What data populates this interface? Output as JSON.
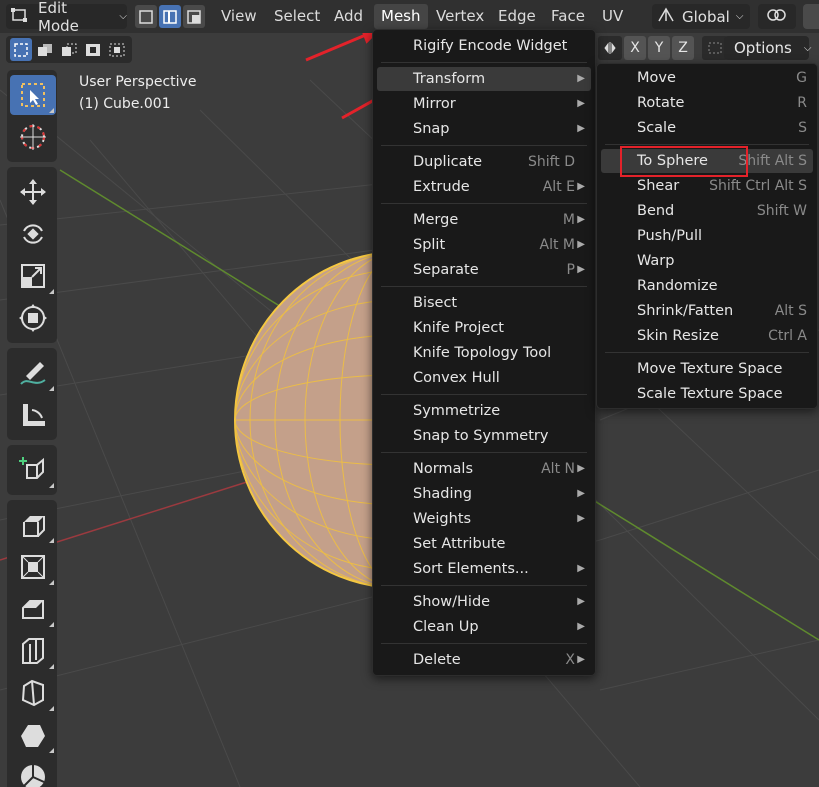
{
  "header": {
    "mode": "Edit Mode",
    "menus": [
      "View",
      "Select",
      "Add",
      "Mesh",
      "Vertex",
      "Edge",
      "Face",
      "UV"
    ],
    "active_menu": "Mesh",
    "orientation": "Global",
    "axes": [
      "X",
      "Y",
      "Z"
    ],
    "options": "Options"
  },
  "viewport": {
    "perspective": "User Perspective",
    "object": "(1) Cube.001"
  },
  "colors": {
    "accent": "#4772b3",
    "menu_bg": "#191919",
    "highlight_red": "#e3222a",
    "sphere": "#c8a48c",
    "wire": "#f5c842"
  },
  "mesh_menu": {
    "items": [
      {
        "label": "Rigify Encode Widget",
        "shortcut": "",
        "submenu": false
      },
      {
        "label": "Transform",
        "shortcut": "",
        "submenu": true
      },
      {
        "label": "Mirror",
        "shortcut": "",
        "submenu": true
      },
      {
        "label": "Snap",
        "shortcut": "",
        "submenu": true
      },
      {
        "label": "Duplicate",
        "shortcut": "Shift D",
        "submenu": false
      },
      {
        "label": "Extrude",
        "shortcut": "Alt E",
        "submenu": true
      },
      {
        "label": "Merge",
        "shortcut": "M",
        "submenu": true
      },
      {
        "label": "Split",
        "shortcut": "Alt M",
        "submenu": true
      },
      {
        "label": "Separate",
        "shortcut": "P",
        "submenu": true
      },
      {
        "label": "Bisect",
        "shortcut": "",
        "submenu": false
      },
      {
        "label": "Knife Project",
        "shortcut": "",
        "submenu": false
      },
      {
        "label": "Knife Topology Tool",
        "shortcut": "",
        "submenu": false
      },
      {
        "label": "Convex Hull",
        "shortcut": "",
        "submenu": false
      },
      {
        "label": "Symmetrize",
        "shortcut": "",
        "submenu": false
      },
      {
        "label": "Snap to Symmetry",
        "shortcut": "",
        "submenu": false
      },
      {
        "label": "Normals",
        "shortcut": "Alt N",
        "submenu": true
      },
      {
        "label": "Shading",
        "shortcut": "",
        "submenu": true
      },
      {
        "label": "Weights",
        "shortcut": "",
        "submenu": true
      },
      {
        "label": "Set Attribute",
        "shortcut": "",
        "submenu": false
      },
      {
        "label": "Sort Elements...",
        "shortcut": "",
        "submenu": true
      },
      {
        "label": "Show/Hide",
        "shortcut": "",
        "submenu": true
      },
      {
        "label": "Clean Up",
        "shortcut": "",
        "submenu": true
      },
      {
        "label": "Delete",
        "shortcut": "X",
        "submenu": true
      }
    ]
  },
  "transform_menu": {
    "items": [
      {
        "label": "Move",
        "shortcut": "G"
      },
      {
        "label": "Rotate",
        "shortcut": "R"
      },
      {
        "label": "Scale",
        "shortcut": "S"
      },
      {
        "label": "To Sphere",
        "shortcut": "Shift Alt S"
      },
      {
        "label": "Shear",
        "shortcut": "Shift Ctrl Alt S"
      },
      {
        "label": "Bend",
        "shortcut": "Shift W"
      },
      {
        "label": "Push/Pull",
        "shortcut": ""
      },
      {
        "label": "Warp",
        "shortcut": ""
      },
      {
        "label": "Randomize",
        "shortcut": ""
      },
      {
        "label": "Shrink/Fatten",
        "shortcut": "Alt S"
      },
      {
        "label": "Skin Resize",
        "shortcut": "Ctrl A"
      },
      {
        "label": "Move Texture Space",
        "shortcut": ""
      },
      {
        "label": "Scale Texture Space",
        "shortcut": ""
      }
    ]
  },
  "toolbar": {
    "tools": [
      "select-box-icon",
      "cursor-icon",
      "move-icon",
      "rotate-icon",
      "scale-icon",
      "transform-icon",
      "annotate-icon",
      "measure-icon",
      "add-cube-icon",
      "extrude-icon",
      "inset-icon",
      "bevel-icon",
      "loop-cut-icon",
      "knife-icon",
      "poly-build-icon",
      "spin-icon"
    ]
  }
}
